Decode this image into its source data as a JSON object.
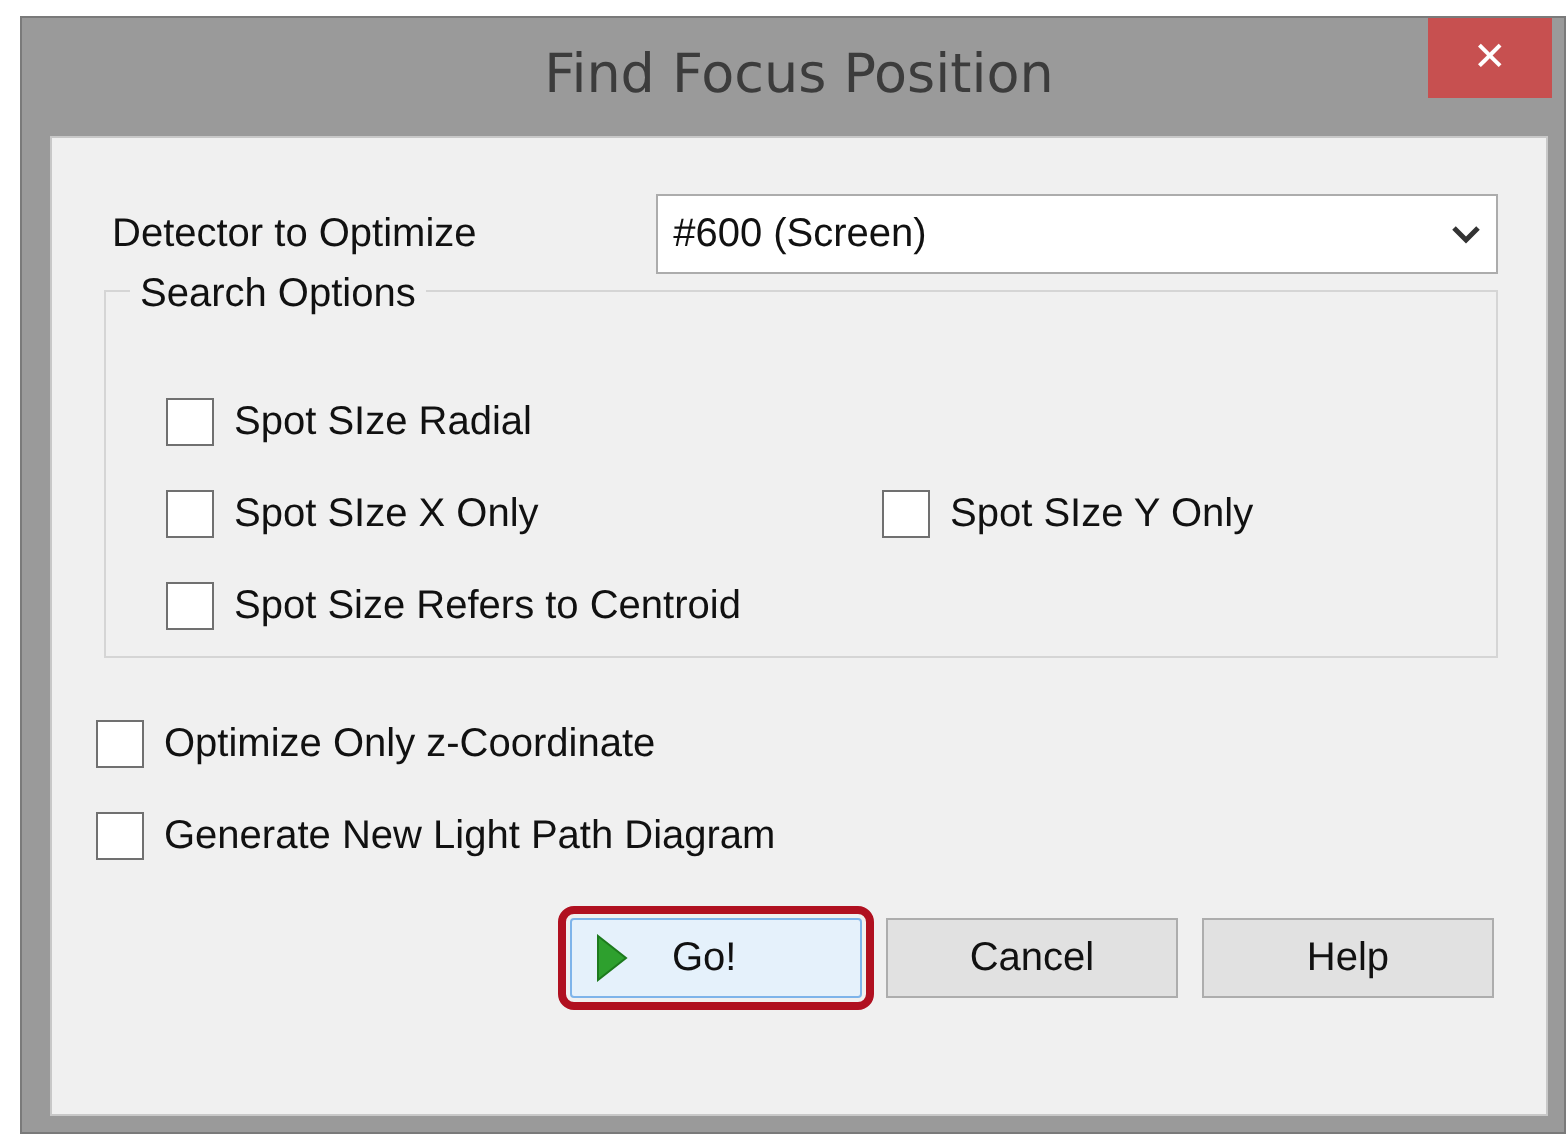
{
  "window": {
    "title": "Find Focus Position",
    "close": "✕"
  },
  "detector": {
    "label": "Detector to Optimize",
    "value": "#600 (Screen)"
  },
  "search_options": {
    "title": "Search Options",
    "rows": [
      [
        {
          "label": "Spot SIze Radial",
          "checked": false
        }
      ],
      [
        {
          "label": "Spot SIze X Only",
          "checked": false
        },
        {
          "label": "Spot SIze Y Only",
          "checked": false
        }
      ],
      [
        {
          "label": "Spot Size Refers to Centroid",
          "checked": false
        }
      ]
    ]
  },
  "options": [
    {
      "label": "Optimize Only z-Coordinate",
      "checked": false
    },
    {
      "label": "Generate New Light Path Diagram",
      "checked": false
    }
  ],
  "buttons": [
    {
      "label": "Go!",
      "kind": "go",
      "highlighted": true
    },
    {
      "label": "Cancel",
      "kind": "plain",
      "highlighted": false
    },
    {
      "label": "Help",
      "kind": "plain",
      "highlighted": false
    }
  ]
}
